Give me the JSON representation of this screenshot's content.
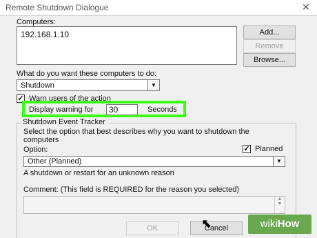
{
  "dialog": {
    "title": "Remote Shutdown Dialogue",
    "close_glyph": "✕"
  },
  "computers": {
    "label": "Computers:",
    "items": [
      "192.168.1.10"
    ],
    "add_label": "Add...",
    "remove_label": "Remove",
    "browse_label": "Browse..."
  },
  "action": {
    "label": "What do you want these computers to do:",
    "selected": "Shutdown"
  },
  "warn": {
    "checked": true,
    "label": "Warn users of the action",
    "display_label": "Display warning for",
    "seconds_value": "30",
    "seconds_label": "Seconds"
  },
  "tracker": {
    "title": "Shutdown Event Tracker",
    "description": "Select the option that best describes why you want to shutdown the computers",
    "option_label": "Option:",
    "planned_checked": true,
    "planned_label": "Planned",
    "option_selected": "Other (Planned)",
    "option_description": "A shutdown or restart for an unknown reason",
    "comment_label": "Comment:  (This field is REQUIRED for the reason you selected)"
  },
  "footer": {
    "ok_label": "OK",
    "cancel_label": "Cancel"
  },
  "watermark": {
    "wiki": "wiki",
    "how": "How",
    "color": "#6aa84f"
  },
  "colors": {
    "highlight": "#39ff14"
  }
}
